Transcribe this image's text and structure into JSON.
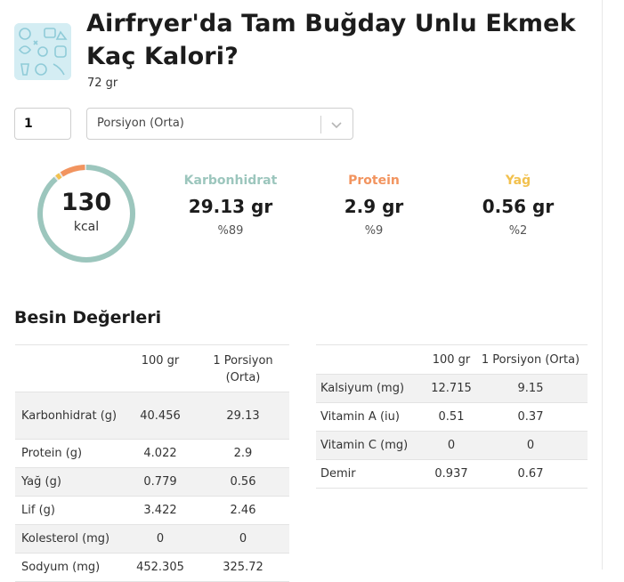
{
  "food": {
    "title": "Airfryer'da Tam Buğday Unlu Ekmek Kaç Kalori?",
    "weight": "72 gr"
  },
  "portion": {
    "quantity": "1",
    "selected": "Porsiyon (Orta)"
  },
  "summary": {
    "calories": "130",
    "unit": "kcal",
    "macros": [
      {
        "label": "Karbonhidrat",
        "amount": "29.13 gr",
        "percent": "%89",
        "color": "#9cc6bd",
        "share": 0.89
      },
      {
        "label": "Protein",
        "amount": "2.9 gr",
        "percent": "%9",
        "color": "#f2945f",
        "share": 0.09
      },
      {
        "label": "Yağ",
        "amount": "0.56 gr",
        "percent": "%2",
        "color": "#f2c14e",
        "share": 0.02
      }
    ]
  },
  "nutrition": {
    "title": "Besin Değerleri",
    "left_table": {
      "headers": [
        "",
        "100 gr",
        "1 Porsiyon (Orta)"
      ],
      "rows": [
        [
          "Karbonhidrat (g)",
          "40.456",
          "29.13"
        ],
        [
          "Protein (g)",
          "4.022",
          "2.9"
        ],
        [
          "Yağ (g)",
          "0.779",
          "0.56"
        ],
        [
          "Lif (g)",
          "3.422",
          "2.46"
        ],
        [
          "Kolesterol (mg)",
          "0",
          "0"
        ],
        [
          "Sodyum (mg)",
          "452.305",
          "325.72"
        ]
      ]
    },
    "right_table": {
      "headers": [
        "",
        "100 gr",
        "1 Porsiyon (Orta)"
      ],
      "rows": [
        [
          "Kalsiyum (mg)",
          "12.715",
          "9.15"
        ],
        [
          "Vitamin A (iu)",
          "0.51",
          "0.37"
        ],
        [
          "Vitamin C (mg)",
          "0",
          "0"
        ],
        [
          "Demir",
          "0.937",
          "0.67"
        ]
      ]
    }
  }
}
